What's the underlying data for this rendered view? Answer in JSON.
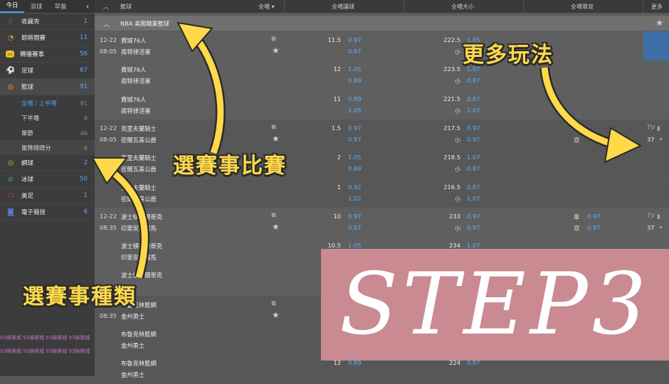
{
  "sidebar": {
    "tabs": [
      {
        "label": "今日"
      },
      {
        "label": "滾球"
      },
      {
        "label": "早盤"
      }
    ],
    "back_glyph": "‹",
    "sports": [
      {
        "label": "收藏夾",
        "count": "1",
        "icon": "star-icon",
        "color": "#e05a5a"
      },
      {
        "label": "即將開賽",
        "count": "11",
        "icon": "clock-icon",
        "color": "#d9a23a"
      },
      {
        "label": "轉播賽事",
        "count": "56",
        "icon": "tv-icon",
        "color": "#e8c21c"
      },
      {
        "label": "足球",
        "count": "67",
        "icon": "soccer-icon",
        "color": "#4caf50"
      },
      {
        "label": "籃球",
        "count": "91",
        "icon": "basketball-icon",
        "color": "#e07b39"
      }
    ],
    "basketball_subs": [
      {
        "label": "全場 / 上半場",
        "count": "91"
      },
      {
        "label": "下半場",
        "count": "8"
      },
      {
        "label": "單節",
        "count": "46"
      },
      {
        "label": "單隊總得分",
        "count": "8"
      }
    ],
    "sports2": [
      {
        "label": "網球",
        "count": "2",
        "icon": "tennis-icon",
        "color": "#9acd32"
      },
      {
        "label": "冰球",
        "count": "50",
        "icon": "hockey-icon",
        "color": "#3aaa8a"
      },
      {
        "label": "美足",
        "count": "1",
        "icon": "football-icon",
        "color": "#d9534f"
      },
      {
        "label": "電子競技",
        "count": "6",
        "icon": "gamepad-icon",
        "color": "#5b7ee0"
      }
    ],
    "watermark": "93娛樂城  93娛樂城  93娛樂城  93娛樂城"
  },
  "header": {
    "sport": "籃球",
    "period": "全場",
    "col_handicap": "全場讓球",
    "col_total": "全場大小",
    "col_oddeven": "全場單双",
    "col_more": "更多"
  },
  "league": "NBA 美國職業籃球",
  "rows": [
    {
      "date": "12-22",
      "time": "08:05",
      "home": "費城76人",
      "away": "底特律活塞",
      "hcp": "11.5",
      "hcp_home": "0.97",
      "hcp_away": "0.97",
      "tot": "222.5",
      "tot_o": "1.05",
      "tot_u": "0.97",
      "u": "小",
      "oe": "",
      "more": "37",
      "tv": "TV"
    },
    {
      "home": "費城76人",
      "away": "底特律活塞",
      "hcp": "12",
      "hcp_home": "1.05",
      "hcp_away": "0.89",
      "tot": "223.5",
      "tot_o": "1.07",
      "tot_u": "0.87",
      "u": "小"
    },
    {
      "home": "費城76人",
      "away": "底特律活塞",
      "hcp": "11",
      "hcp_home": "0.89",
      "hcp_away": "1.05",
      "tot": "221.5",
      "tot_o": "0.87",
      "tot_u": "1.07",
      "u": "小"
    },
    {
      "date": "12-22",
      "time": "08:05",
      "home": "克里夫蘭騎士",
      "away": "密爾瓦基公鹿",
      "hcp": "1.5",
      "hcp_home": "0.97",
      "hcp_away": "0.97",
      "tot": "217.5",
      "tot_o": "0.97",
      "tot_u": "0.97",
      "u": "小",
      "oe": "双",
      "more": "37",
      "tv": "TV"
    },
    {
      "home": "克里夫蘭騎士",
      "away": "密爾瓦基公鹿",
      "hcp": "2",
      "hcp_home": "1.05",
      "hcp_away": "0.89",
      "tot": "218.5",
      "tot_o": "1.07",
      "tot_u": "0.87",
      "u": "小"
    },
    {
      "home": "克里夫蘭騎士",
      "away": "密爾瓦基公鹿",
      "hcp": "1",
      "hcp_home": "0.92",
      "hcp_away": "1.02",
      "tot": "216.5",
      "tot_o": "0.87",
      "tot_u": "1.07",
      "u": "小"
    },
    {
      "date": "12-22",
      "time": "08:35",
      "home": "波士頓塞爾蒂克",
      "away": "印第安納溜馬",
      "hcp": "10",
      "hcp_home": "0.97",
      "hcp_away": "0.97",
      "tot": "233",
      "tot_o": "0.97",
      "tot_u": "0.97",
      "u": "小",
      "oe_home": "單",
      "oe_home_v": "0.97",
      "oe_away": "双",
      "oe_away_v": "0.97",
      "more": "37",
      "tv": "TV"
    },
    {
      "home": "波士頓塞爾蒂克",
      "away": "印第安納溜馬",
      "hcp": "10.5",
      "hcp_home": "1.05",
      "tot": "234",
      "tot_o": "1.07"
    },
    {
      "home": "波士頓塞爾蒂克",
      "away": "",
      "hcp": "",
      "tot": ""
    },
    {
      "date": "12-22",
      "time": "08:35",
      "home": "布魯克林籃網",
      "away": "金州勇士"
    },
    {
      "home": "布魯克林籃網",
      "away": "金州勇士"
    },
    {
      "home": "布魯克林籃網",
      "away": "金州勇士",
      "hcp": "12",
      "hcp_home": "0.89",
      "tot": "224",
      "tot_o": "0.87"
    }
  ],
  "annotations": {
    "match": "選賽事比賽",
    "type": "選賽事種類",
    "more": "更多玩法"
  },
  "step": "STEP3",
  "colors": {
    "accent": "#4aa3ff",
    "arrow": "#ffd94a",
    "step_bg": "#c98a91"
  }
}
